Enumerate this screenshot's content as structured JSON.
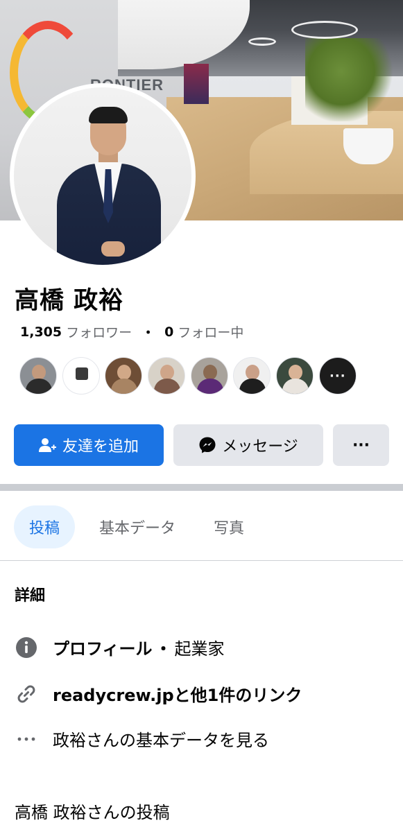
{
  "cover": {
    "logo_text": "RONTIER"
  },
  "profile": {
    "name": "高橋 政裕",
    "followers_count": "1,305",
    "followers_label": "フォロワー",
    "separator": "・",
    "following_count": "0",
    "following_label": "フォロー中"
  },
  "mutual_friends": {
    "more_label": "···"
  },
  "actions": {
    "add_friend_label": "友達を追加",
    "message_label": "メッセージ",
    "more_label": "···"
  },
  "tabs": [
    {
      "label": "投稿",
      "active": true
    },
    {
      "label": "基本データ",
      "active": false
    },
    {
      "label": "写真",
      "active": false
    }
  ],
  "details": {
    "title": "詳細",
    "profile_type": "プロフィール",
    "profile_sep": "・",
    "occupation": "起業家",
    "links": "readycrew.jpと他1件のリンク",
    "about_link": "政裕さんの基本データを見る"
  },
  "posts": {
    "title": "高橋 政裕さんの投稿"
  },
  "colors": {
    "accent": "#1b74e4",
    "button_gray": "#e4e6eb",
    "tab_active_bg": "#e7f3ff",
    "secondary_text": "#65676b"
  }
}
